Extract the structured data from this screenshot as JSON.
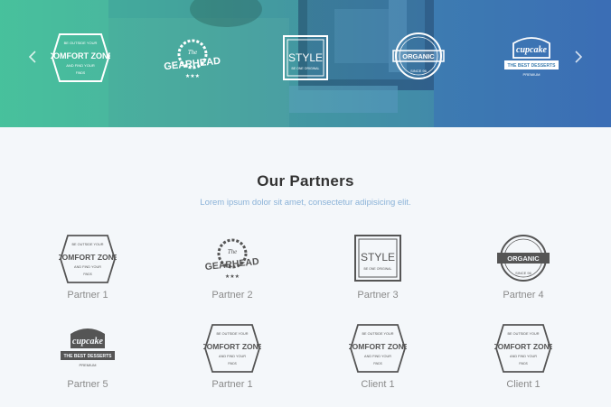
{
  "hero": {
    "prev_icon": "chevron-left-icon",
    "next_icon": "chevron-right-icon",
    "logos": [
      {
        "name": "comfort-zone",
        "lines": [
          "BE OUTSIDE YOUR",
          "COMFORT ZONE",
          "AND FIND YOUR",
          "FINDS"
        ]
      },
      {
        "name": "gearhead",
        "lines": [
          "The",
          "GEARHEAD"
        ]
      },
      {
        "name": "style",
        "lines": [
          "STYLE",
          "BE ONE ORIGINAL"
        ]
      },
      {
        "name": "organic",
        "lines": [
          "ORGANIC",
          "SINCE 96"
        ]
      },
      {
        "name": "cupcake",
        "lines": [
          "cupcake",
          "THE BEST DESSERTS",
          "PREMIUM"
        ]
      }
    ]
  },
  "partners": {
    "title": "Our Partners",
    "subtitle": "Lorem ipsum dolor sit amet, consectetur adipisicing elit.",
    "items": [
      {
        "label": "Partner 1",
        "logo": "comfort-zone"
      },
      {
        "label": "Partner 2",
        "logo": "gearhead"
      },
      {
        "label": "Partner 3",
        "logo": "style"
      },
      {
        "label": "Partner 4",
        "logo": "organic"
      },
      {
        "label": "Partner 5",
        "logo": "cupcake"
      },
      {
        "label": "Partner 1",
        "logo": "comfort-zone"
      },
      {
        "label": "Client 1",
        "logo": "comfort-zone"
      },
      {
        "label": "Client 1",
        "logo": "comfort-zone"
      }
    ]
  },
  "colors": {
    "logo_dark": "#555555",
    "subtitle": "#8ab2d8",
    "background": "#f4f7fa"
  }
}
